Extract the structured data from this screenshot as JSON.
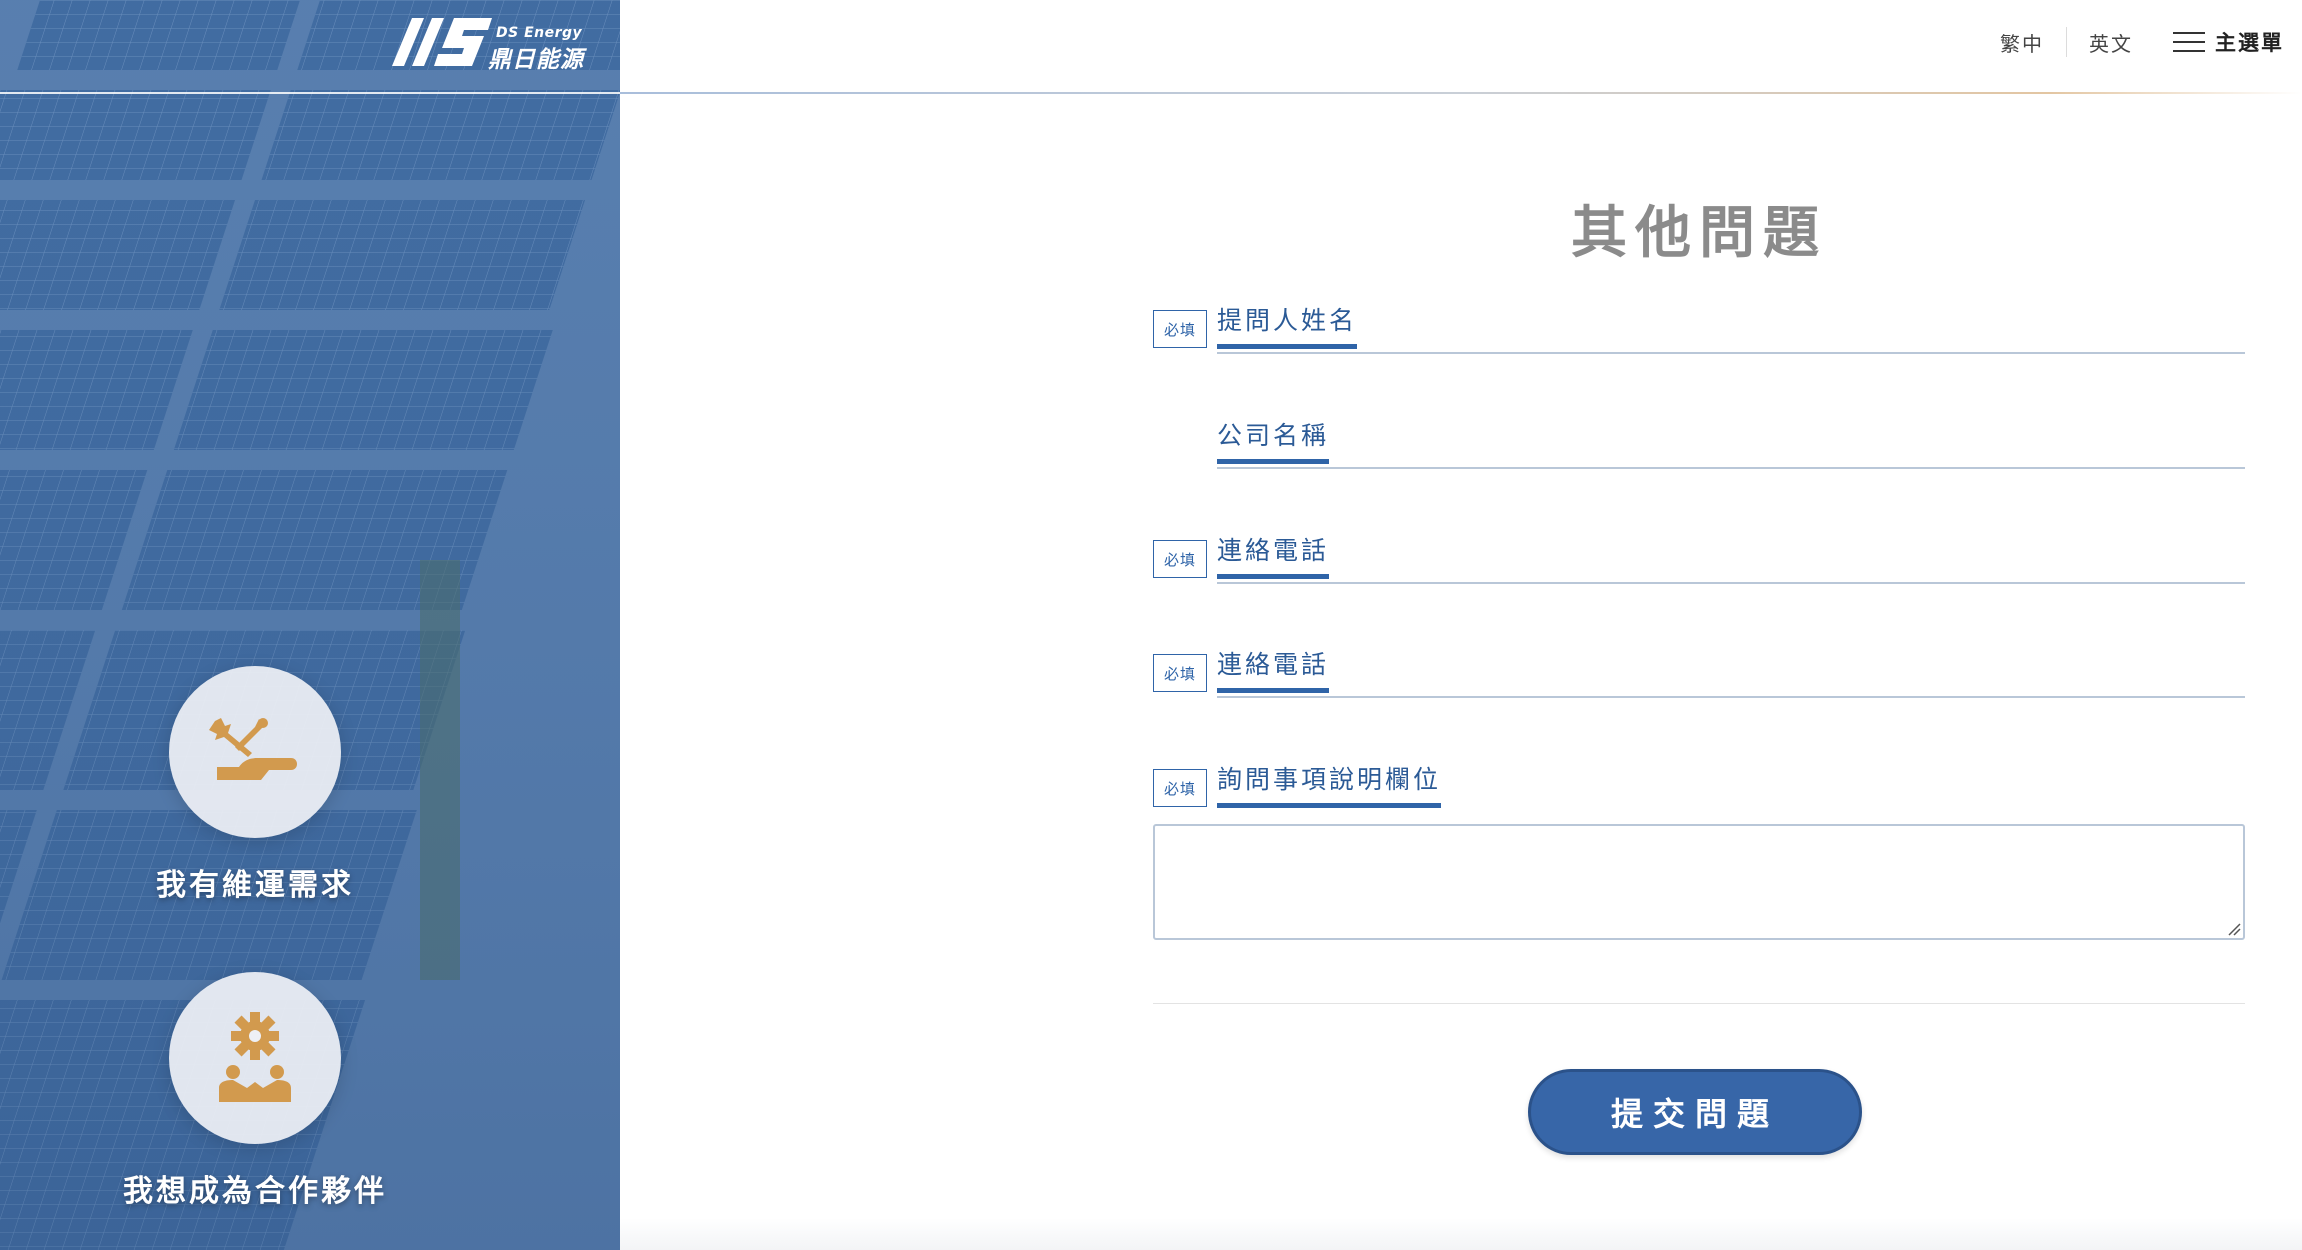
{
  "brand": {
    "name_en": "DS Energy",
    "name_zh": "鼎日能源"
  },
  "nav": {
    "lang_tc": "繁中",
    "lang_en": "英文",
    "menu_label": "主選單"
  },
  "sidebar": {
    "links": [
      {
        "label": "我有維運需求",
        "icon": "tools-hand-icon"
      },
      {
        "label": "我想成為合作夥伴",
        "icon": "gear-people-icon"
      }
    ]
  },
  "form": {
    "title": "其他問題",
    "required_badge": "必填",
    "fields": [
      {
        "label": "提問人姓名",
        "required": true,
        "value": ""
      },
      {
        "label": "公司名稱",
        "required": false,
        "value": ""
      },
      {
        "label": "連絡電話",
        "required": true,
        "value": ""
      },
      {
        "label": "連絡電話",
        "required": true,
        "value": ""
      },
      {
        "label": "詢問事項說明欄位",
        "required": true,
        "value": ""
      }
    ],
    "submit_label": "提交問題"
  },
  "colors": {
    "accent": "#2f64a8",
    "icon_gold": "#d29a4e",
    "title_gray": "#8b8b8b",
    "panel_blue": "#4d77a9"
  }
}
